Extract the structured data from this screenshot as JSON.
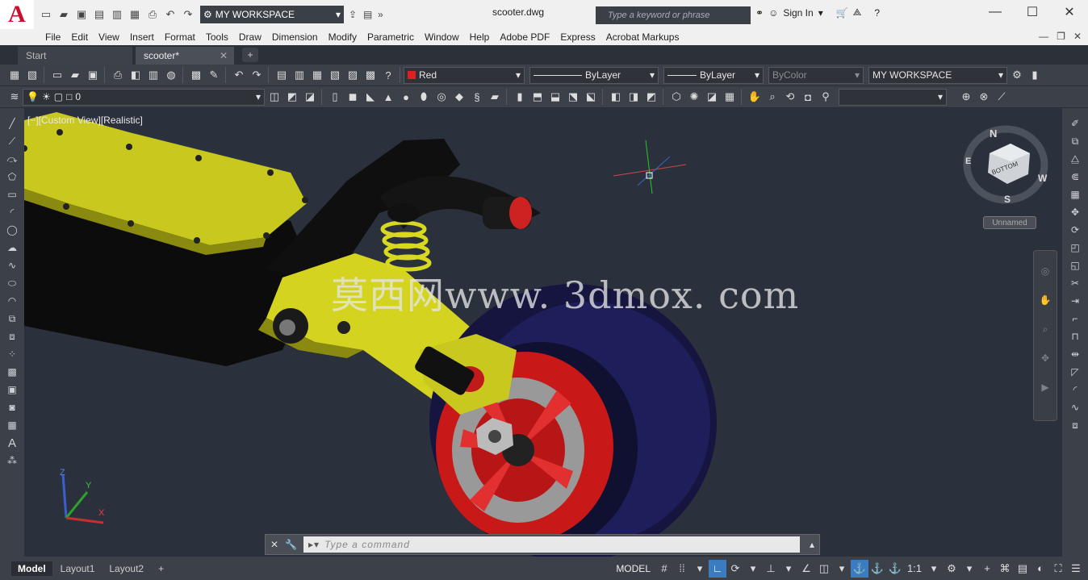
{
  "app": {
    "logo_letter": "A",
    "title": "scooter.dwg",
    "accent": "#c8102e"
  },
  "quick_access": {
    "workspace": "MY WORKSPACE"
  },
  "search": {
    "placeholder": "Type a keyword or phrase"
  },
  "account": {
    "sign_in": "Sign In"
  },
  "menu": [
    "File",
    "Edit",
    "View",
    "Insert",
    "Format",
    "Tools",
    "Draw",
    "Dimension",
    "Modify",
    "Parametric",
    "Window",
    "Help",
    "Adobe PDF",
    "Express",
    "Acrobat Markups"
  ],
  "doc_tabs": [
    {
      "label": "Start"
    },
    {
      "label": "scooter*"
    }
  ],
  "properties": {
    "color": "Red",
    "color_swatch": "#e02020",
    "linetype": "ByLayer",
    "lineweight": "ByLayer",
    "plotstyle": "ByColor",
    "workspace": "MY WORKSPACE"
  },
  "layers": {
    "current": "0"
  },
  "viewport": {
    "label": "[−][Custom View][Realistic]",
    "watermark": "莫西网www. 3dmox. com",
    "background": "#2b313c"
  },
  "viewcube": {
    "face": "BOTTOM",
    "north": "N",
    "south": "S",
    "east": "E",
    "west": "W",
    "ucs_name": "Unnamed"
  },
  "ucs": {
    "z": "Z",
    "y": "Y",
    "x": "X"
  },
  "command": {
    "placeholder": "Type a command"
  },
  "layout_tabs": [
    {
      "label": "Model",
      "active": true
    },
    {
      "label": "Layout1"
    },
    {
      "label": "Layout2"
    }
  ],
  "status": {
    "space": "MODEL",
    "scale": "1:1"
  }
}
